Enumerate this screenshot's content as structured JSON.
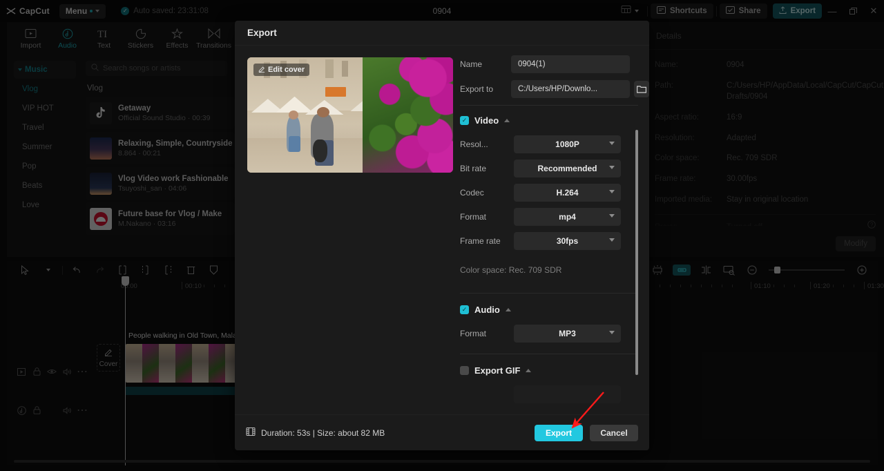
{
  "window": {
    "app_name": "CapCut",
    "menu_label": "Menu",
    "autosave_text": "Auto saved: 23:31:08",
    "project_title": "0904",
    "shortcuts_label": "Shortcuts",
    "share_label": "Share",
    "export_label": "Export",
    "minimize_icon": "minimize-icon",
    "maximize_icon": "maximize-icon",
    "close_icon": "close-icon",
    "layout_icon": "layout-icon"
  },
  "tool_tabs": [
    {
      "label": "Import",
      "icon": "import-icon",
      "active": false
    },
    {
      "label": "Audio",
      "icon": "audio-note-icon",
      "active": true
    },
    {
      "label": "Text",
      "icon": "text-icon",
      "active": false
    },
    {
      "label": "Stickers",
      "icon": "sticker-icon",
      "active": false
    },
    {
      "label": "Effects",
      "icon": "effects-sparkle-icon",
      "active": false
    },
    {
      "label": "Transitions",
      "icon": "transitions-icon",
      "active": false
    }
  ],
  "media_panel": {
    "categories": [
      {
        "label": "Music",
        "group": true
      },
      {
        "label": "Vlog",
        "selected": true
      },
      {
        "label": "VIP HOT"
      },
      {
        "label": "Travel"
      },
      {
        "label": "Summer"
      },
      {
        "label": "Pop"
      },
      {
        "label": "Beats"
      },
      {
        "label": "Love"
      }
    ],
    "search_placeholder": "Search songs or artists",
    "search_value": "",
    "section_title": "Vlog",
    "songs": [
      {
        "name": "Getaway",
        "sub": "Official Sound Studio · 00:39"
      },
      {
        "name": "Relaxing, Simple, Countryside",
        "sub": "8.864 · 00:21"
      },
      {
        "name": "Vlog Video work Fashionable",
        "sub": "Tsuyoshi_san · 04:06"
      },
      {
        "name": "Future base for Vlog / Make",
        "sub": "M.Nakano · 03:16"
      }
    ]
  },
  "details_panel": {
    "title": "Details",
    "rows": [
      {
        "key": "Name:",
        "value": "0904"
      },
      {
        "key": "Path:",
        "value": "C:/Users/HP/AppData/Local/CapCut/CapCut Drafts/0904"
      },
      {
        "key": "Aspect ratio:",
        "value": "16:9"
      },
      {
        "key": "Resolution:",
        "value": "Adapted"
      },
      {
        "key": "Color space:",
        "value": "Rec. 709 SDR"
      },
      {
        "key": "Frame rate:",
        "value": "30.00fps"
      },
      {
        "key": "Imported media:",
        "value": "Stay in original location"
      }
    ],
    "partial_row": {
      "key": "Proxy:",
      "value": "Turned off"
    },
    "modify_label": "Modify",
    "help_icon": "help-circle-icon"
  },
  "timeline": {
    "tools": [
      "select-cursor-icon",
      "chevron-down-icon",
      "undo-icon",
      "redo-icon",
      "split-left-icon",
      "split-icon",
      "split-right-icon",
      "delete-icon",
      "freeze-icon"
    ],
    "right_tools": [
      "mirror-icon",
      "crop-icon",
      "speed-icon",
      "cut-marker-icon",
      "frame-preview-icon",
      "zoom-out-icon",
      "zoom-in-icon"
    ],
    "ruler_labels": [
      "00:00",
      "00:10",
      "01:10",
      "01:20",
      "01:30"
    ],
    "cover_label": "Cover",
    "clip_title": "People walking in Old Town, Mala",
    "track_head_icons_video": [
      "video-track-icon",
      "lock-icon",
      "eye-icon",
      "volume-icon",
      "more-icon"
    ],
    "track_head_icons_audio": [
      "audio-track-icon",
      "lock-icon",
      "volume-icon",
      "more-icon"
    ]
  },
  "dialog": {
    "title": "Export",
    "edit_cover_label": "Edit cover",
    "fields": [
      {
        "label": "Name",
        "value": "0904(1)"
      },
      {
        "label": "Export to",
        "value": "C:/Users/HP/Downlo..."
      }
    ],
    "folder_icon": "folder-icon",
    "video_section": {
      "name": "Video",
      "checked": true,
      "options": [
        {
          "label": "Resol...",
          "value": "1080P"
        },
        {
          "label": "Bit rate",
          "value": "Recommended"
        },
        {
          "label": "Codec",
          "value": "H.264"
        },
        {
          "label": "Format",
          "value": "mp4"
        },
        {
          "label": "Frame rate",
          "value": "30fps"
        }
      ],
      "note": "Color space: Rec. 709 SDR"
    },
    "audio_section": {
      "name": "Audio",
      "checked": true,
      "options": [
        {
          "label": "Format",
          "value": "MP3"
        }
      ]
    },
    "gif_section": {
      "name": "Export GIF",
      "checked": false
    },
    "footer": {
      "duration_text": "Duration: 53s | Size: about 82 MB",
      "film_icon": "film-icon",
      "export_label": "Export",
      "cancel_label": "Cancel"
    }
  },
  "annotation": {
    "arrow_color": "#ff1a1a",
    "points_to": "export-button"
  },
  "colors": {
    "accent_cyan": "#22c8e0",
    "accent_teal": "#1fa8b4",
    "dialog_bg": "#1b1b1b",
    "app_bg": "#0d0d0d"
  }
}
